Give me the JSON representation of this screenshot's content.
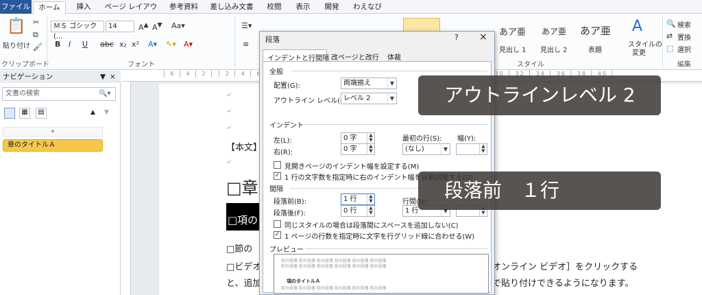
{
  "tabs": [
    "ファイル",
    "ホーム",
    "挿入",
    "ページ レイアウト",
    "参考資料",
    "差し込み文書",
    "校閲",
    "表示",
    "開発",
    "わえなび"
  ],
  "ribbon": {
    "clipboard": {
      "paste": "貼り付け",
      "group": "クリップボード"
    },
    "font": {
      "name": "ＭＳ ゴシック (...",
      "size": "14",
      "group": "フォント"
    },
    "styles": {
      "s1": "見出し 1",
      "s2": "見出し 2",
      "s3": "表題",
      "change": "スタイルの",
      "change2": "変更",
      "group": "スタイル",
      "sample1": "あア亜",
      "sample2": "あア亜",
      "sample3": "あア亜"
    },
    "editing": {
      "find": "検索",
      "replace": "置換",
      "select": "選択",
      "group": "編集"
    }
  },
  "nav": {
    "title": "ナビゲーション",
    "search_placeholder": "文書の検索",
    "heading_item": "章のタイトルＡ"
  },
  "document": {
    "body_label": "【本文】",
    "chapter": "□章",
    "section": "□項の",
    "line1": "□節の",
    "line2": "□ビデオ",
    "line3": "と、追加",
    "right1": "オンライン ビデオ］をクリックする",
    "right2": "で貼り付けできるようになります。"
  },
  "dialog": {
    "title": "段落",
    "help": "?",
    "close": "×",
    "tabs": [
      "インデントと行間隔",
      "改ページと改行",
      "体裁"
    ],
    "general_label": "全般",
    "alignment_label": "配置(G):",
    "alignment_value": "両端揃え",
    "outline_label": "アウトライン レベル(O):",
    "outline_value": "レベル 2",
    "indent_label": "インデント",
    "left_label": "左(L):",
    "left_value": "0 字",
    "right_label": "右(R):",
    "right_value": "0 字",
    "first_line_label": "最初の行(S):",
    "first_line_value": "(なし)",
    "width_label": "幅(Y):",
    "mirror_label": "見開きページのインデント幅を設定する(M)",
    "auto_adjust_label": "1 行の文字数を指定時に右のインデント幅を自動調整する(D)",
    "spacing_label": "間隔",
    "before_label": "段落前(B):",
    "before_value": "1 行",
    "after_label": "段落後(F):",
    "after_value": "0 行",
    "line_spacing_label": "行間(N):",
    "line_spacing_value": "1 行",
    "no_space_label": "同じスタイルの場合は段落間にスペースを追加しない(C)",
    "grid_label": "1 ページの行数を指定時に文字を行グリッド線に合わせる(W)",
    "preview_label": "プレビュー",
    "preview_heading": "項のタイトルＡ",
    "preview_filler": "前の段落 前の段落 前の段落 前の段落 前の段落 前の段落"
  },
  "captions": {
    "outline": "アウトラインレベル 2",
    "before": "段落前　１行"
  }
}
